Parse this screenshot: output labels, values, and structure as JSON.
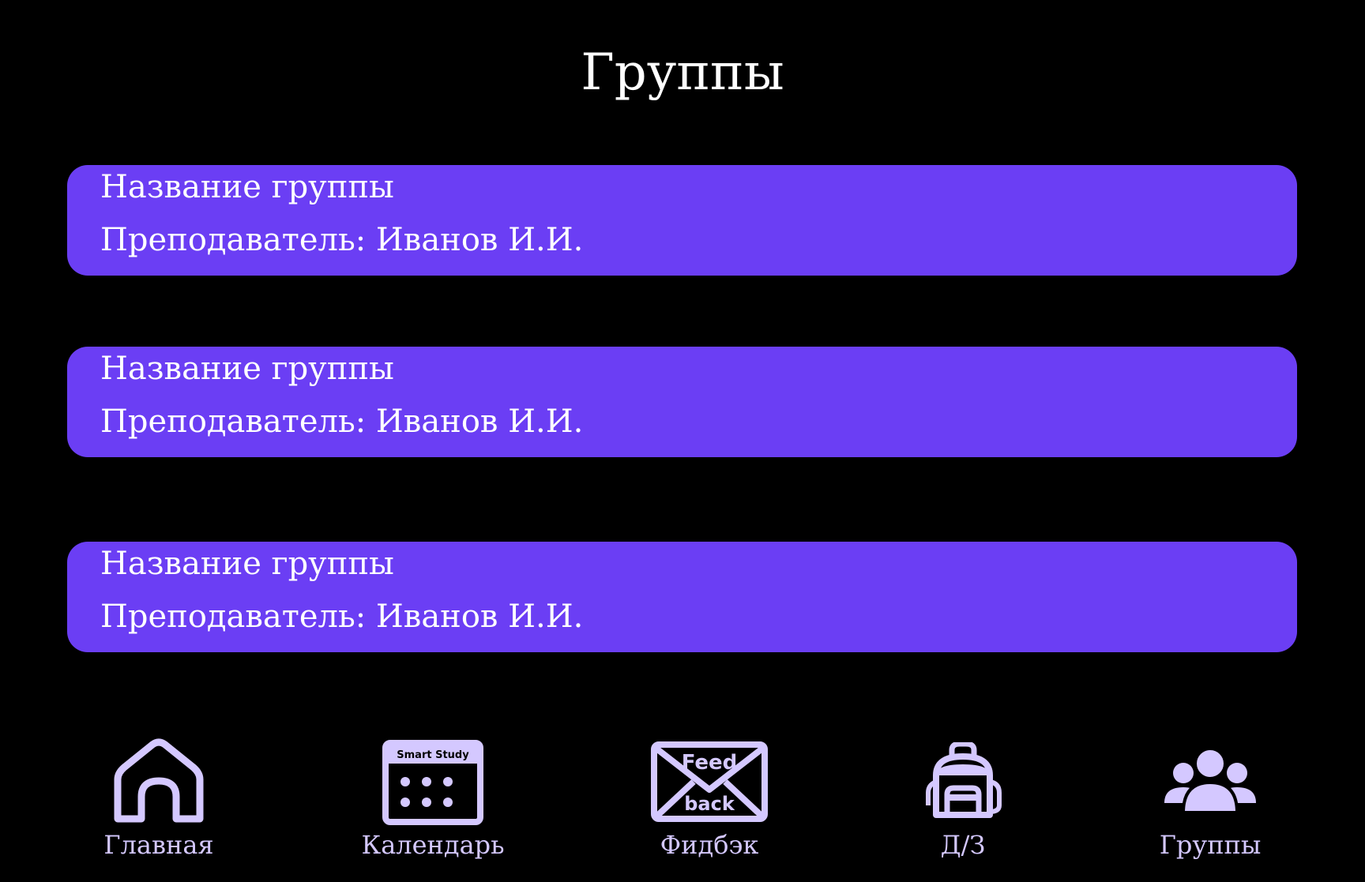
{
  "header": {
    "title": "Группы"
  },
  "groups": [
    {
      "name": "Название группы",
      "teacher": "Преподаватель: Иванов И.И."
    },
    {
      "name": "Название группы",
      "teacher": "Преподаватель: Иванов И.И."
    },
    {
      "name": "Название группы",
      "teacher": "Преподаватель: Иванов И.И."
    }
  ],
  "nav": {
    "items": [
      {
        "label": "Главная",
        "icon": "home-icon"
      },
      {
        "label": "Календарь",
        "icon": "calendar-icon",
        "icon_text": "Smart Study"
      },
      {
        "label": "Фидбэк",
        "icon": "feedback-envelope-icon",
        "icon_text_top": "Feed",
        "icon_text_bottom": "back"
      },
      {
        "label": "Д/З",
        "icon": "backpack-icon"
      },
      {
        "label": "Группы",
        "icon": "users-icon"
      }
    ]
  },
  "colors": {
    "background": "#000000",
    "card": "#6b3ef4",
    "nav_accent": "#d4c8ff",
    "text": "#ffffff"
  }
}
